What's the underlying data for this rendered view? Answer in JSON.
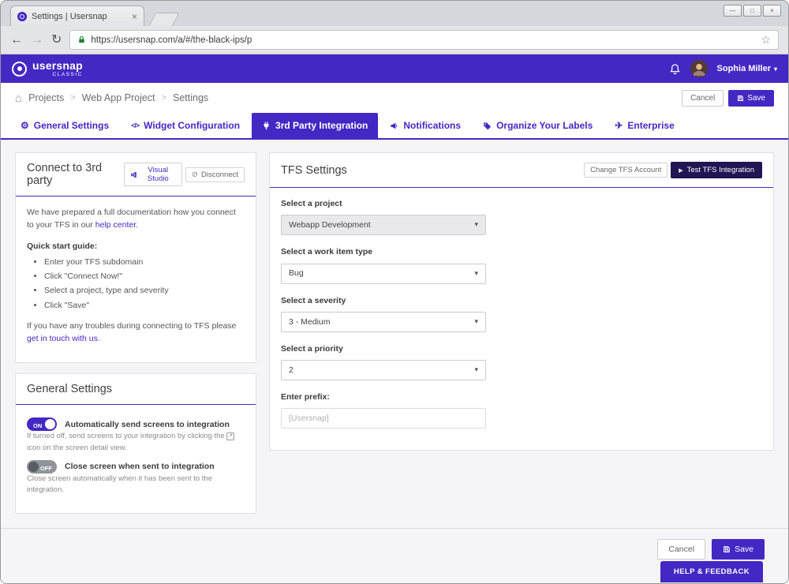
{
  "colors": {
    "brand": "#4527c4",
    "dark_button": "#231453"
  },
  "icons": {
    "close": "×",
    "minimize": "—",
    "maximize": "□",
    "back": "←",
    "forward": "→",
    "refresh": "↻",
    "star": "☆",
    "home": "⌂",
    "caret_down": "▾",
    "play": "▶",
    "gear": "⚙",
    "code": "</>",
    "plane": "✈",
    "external_link": "↗",
    "disconnect": "⊘"
  },
  "browser": {
    "tab_title": "Settings | Usersnap",
    "url": "https://usersnap.com/a/#/the-black-ips/p"
  },
  "header": {
    "logo_text": "usersnap",
    "logo_sub": "CLASSIC",
    "user_name": "Sophia Miller"
  },
  "breadcrumb": {
    "items": [
      "Projects",
      "Web App Project",
      "Settings"
    ],
    "separator": ">",
    "cancel_label": "Cancel",
    "save_label": "Save"
  },
  "tabs": [
    {
      "label": "General Settings",
      "icon": "gear-icon"
    },
    {
      "label": "Widget Configuration",
      "icon": "code-icon"
    },
    {
      "label": "3rd Party Integration",
      "icon": "plug-icon",
      "active": true
    },
    {
      "label": "Notifications",
      "icon": "megaphone-icon"
    },
    {
      "label": "Organize Your Labels",
      "icon": "tag-icon"
    },
    {
      "label": "Enterprise",
      "icon": "plane-icon"
    }
  ],
  "connect_card": {
    "title": "Connect to 3rd party",
    "visual_studio_label": "Visual Studio",
    "disconnect_label": "Disconnect",
    "intro_text": "We have prepared a full documentation how you connect to your TFS in our",
    "intro_link": "help center",
    "period": ".",
    "quick_start_title": "Quick start guide:",
    "steps": [
      "Enter your TFS subdomain",
      "Click \"Connect Now!\"",
      "Select a project, type and severity",
      "Click \"Save\""
    ],
    "troubles_text": "If you have any troubles during connecting to TFS please",
    "troubles_link": "get in touch with us"
  },
  "general_card": {
    "title": "General Settings",
    "toggle1": {
      "state": "ON",
      "label": "Automatically send screens to integration",
      "description_before": "If turned off, send screens to your integration by clicking the",
      "description_after": "icon on the screen detail view."
    },
    "toggle2": {
      "state": "OFF",
      "label": "Close screen when sent to integration",
      "description": "Close screen automatically when it has been sent to the integration."
    }
  },
  "tfs_card": {
    "title": "TFS Settings",
    "change_account_label": "Change TFS Account",
    "test_integration_label": "Test TFS Integration",
    "fields": [
      {
        "label": "Select a project",
        "value": "Webapp Development",
        "type": "select"
      },
      {
        "label": "Select a work item type",
        "value": "Bug",
        "type": "select"
      },
      {
        "label": "Select a severity",
        "value": "3 - Medium",
        "type": "select"
      },
      {
        "label": "Select a priority",
        "value": "2",
        "type": "select"
      },
      {
        "label": "Enter prefix:",
        "placeholder": "[Usersnap]",
        "type": "text"
      }
    ]
  },
  "footer": {
    "cancel_label": "Cancel",
    "save_label": "Save"
  },
  "help_feedback": {
    "label": "HELP & FEEDBACK"
  }
}
